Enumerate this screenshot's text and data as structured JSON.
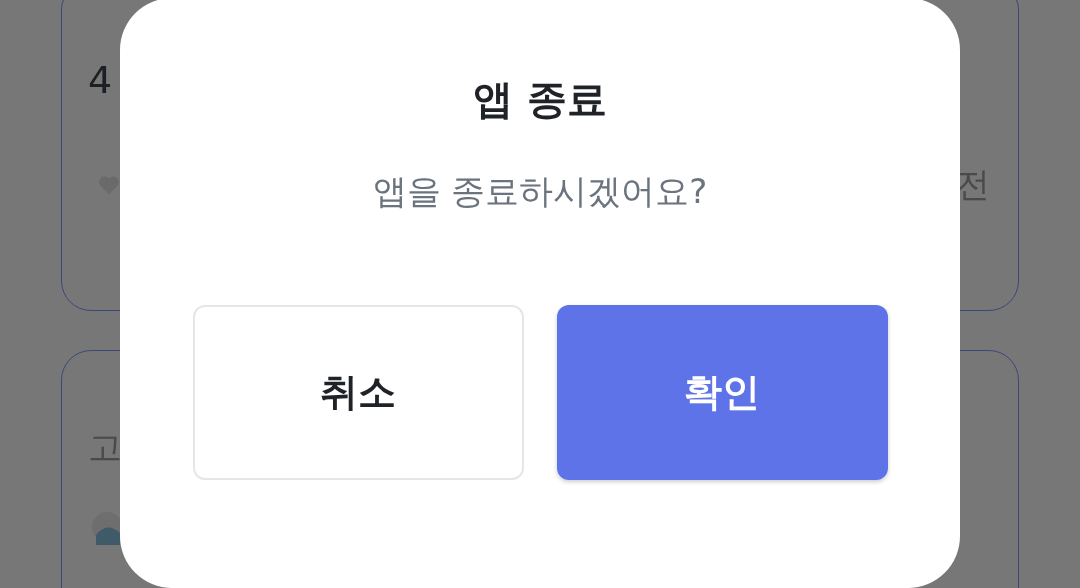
{
  "background": {
    "cards": [
      {
        "value": "4",
        "trailing": "전"
      },
      {
        "label": "고"
      }
    ]
  },
  "dialog": {
    "title": "앱 종료",
    "message": "앱을 종료하시겠어요?",
    "buttons": [
      {
        "label": "취소",
        "kind": "secondary"
      },
      {
        "label": "확인",
        "kind": "primary"
      }
    ]
  }
}
